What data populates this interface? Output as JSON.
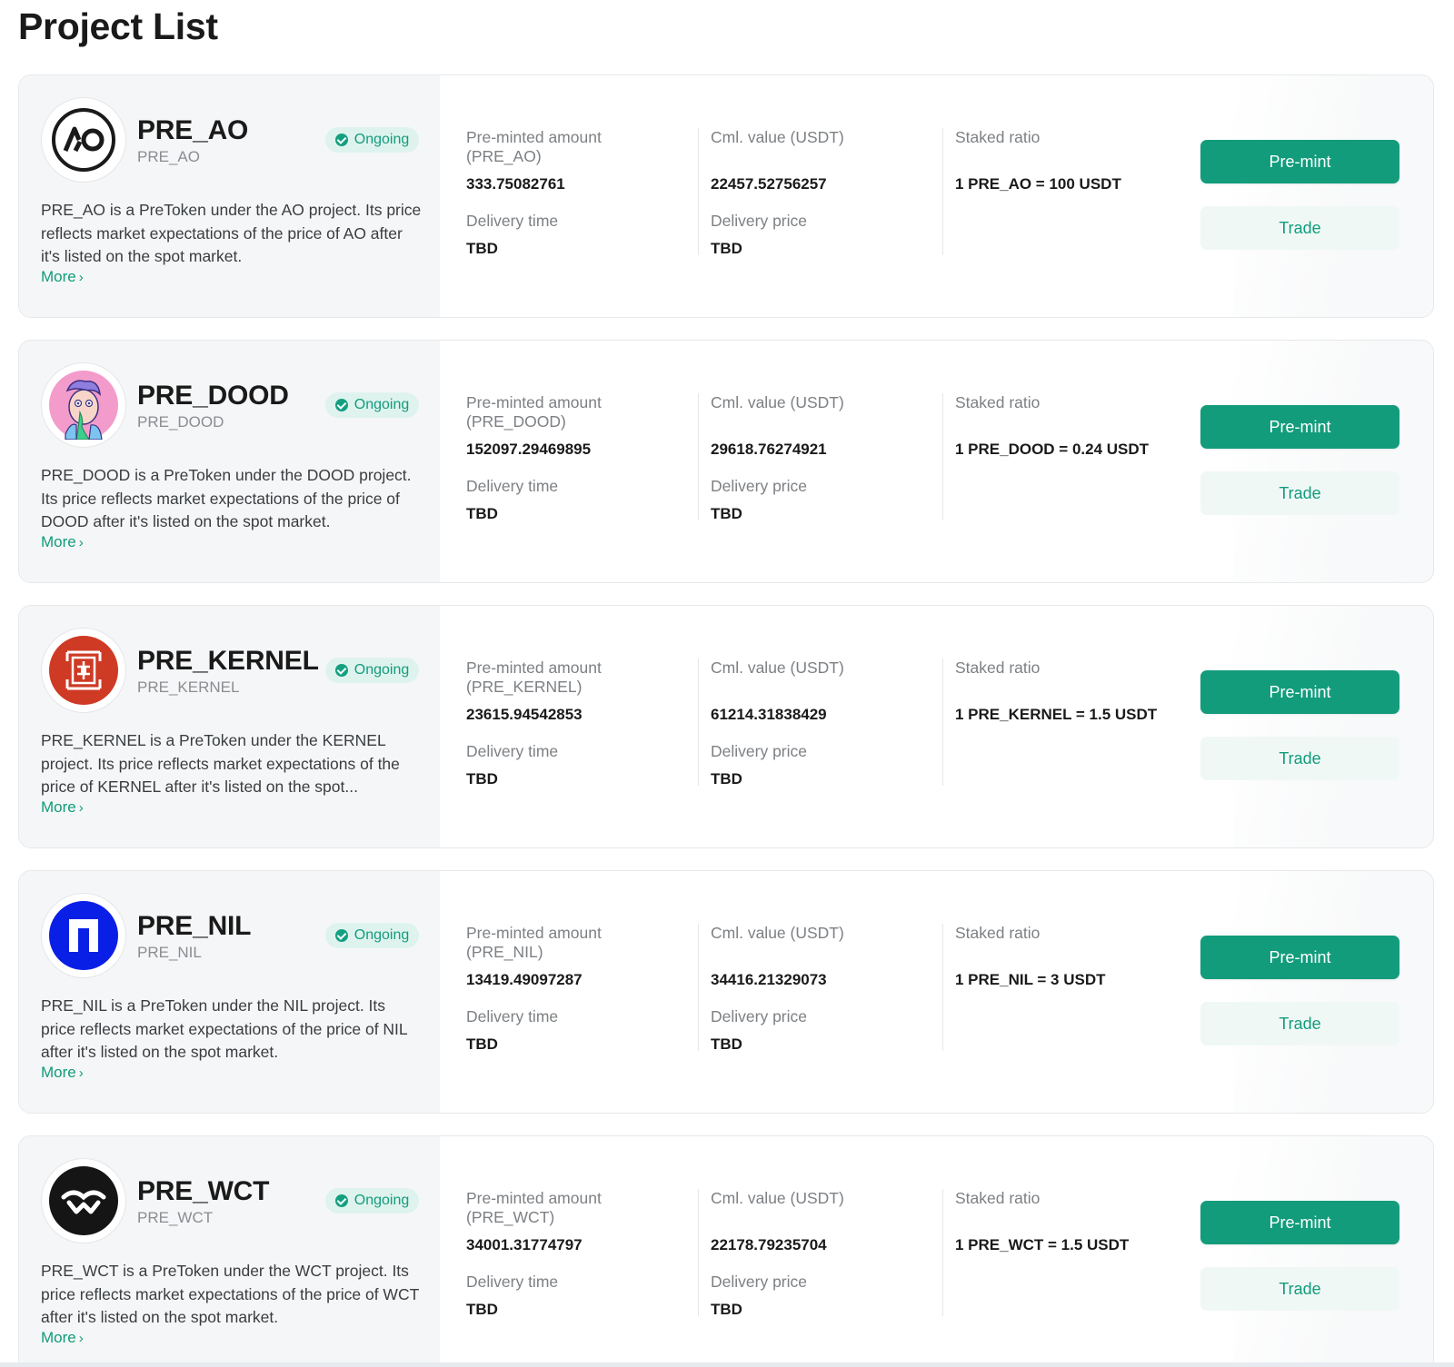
{
  "page": {
    "title": "Project List"
  },
  "colors": {
    "accent": "#129c7c",
    "badge_bg": "#dff3ee",
    "card_left_bg": "#f5f6f7"
  },
  "common": {
    "status": "Ongoing",
    "more": "More",
    "cml_label": "Cml. value (USDT)",
    "staked_label": "Staked ratio",
    "delivery_time_label": "Delivery time",
    "delivery_price_label": "Delivery price",
    "premint_button": "Pre-mint",
    "trade_button": "Trade"
  },
  "projects": [
    {
      "name": "PRE_AO",
      "symbol": "PRE_AO",
      "logo": "ao-logo-icon",
      "description": "PRE_AO is a PreToken under the AO project. Its price reflects market expectations of the price of AO after it's listed on the spot market.",
      "premint_label": "Pre-minted amount (PRE_AO)",
      "premint_amount": "333.75082761",
      "cml_value": "22457.52756257",
      "staked_ratio": "1 PRE_AO = 100 USDT",
      "delivery_time": "TBD",
      "delivery_price": "TBD"
    },
    {
      "name": "PRE_DOOD",
      "symbol": "PRE_DOOD",
      "logo": "dood-avatar-icon",
      "description": "PRE_DOOD is a PreToken under the DOOD project. Its price reflects market expectations of the price of DOOD after it's listed on the spot market.",
      "premint_label": "Pre-minted amount (PRE_DOOD)",
      "premint_amount": "152097.29469895",
      "cml_value": "29618.76274921",
      "staked_ratio": "1 PRE_DOOD = 0.24 USDT",
      "delivery_time": "TBD",
      "delivery_price": "TBD"
    },
    {
      "name": "PRE_KERNEL",
      "symbol": "PRE_KERNEL",
      "logo": "kernel-logo-icon",
      "description": "PRE_KERNEL is a PreToken under the KERNEL project. Its price reflects market expectations of the price of KERNEL after it's listed on the spot...",
      "premint_label": "Pre-minted amount (PRE_KERNEL)",
      "premint_amount": "23615.94542853",
      "cml_value": "61214.31838429",
      "staked_ratio": "1 PRE_KERNEL = 1.5 USDT",
      "delivery_time": "TBD",
      "delivery_price": "TBD"
    },
    {
      "name": "PRE_NIL",
      "symbol": "PRE_NIL",
      "logo": "nil-logo-icon",
      "description": "PRE_NIL is a PreToken under the NIL project. Its price reflects market expectations of the price of NIL after it's listed on the spot market.",
      "premint_label": "Pre-minted amount (PRE_NIL)",
      "premint_amount": "13419.49097287",
      "cml_value": "34416.21329073",
      "staked_ratio": "1 PRE_NIL = 3 USDT",
      "delivery_time": "TBD",
      "delivery_price": "TBD"
    },
    {
      "name": "PRE_WCT",
      "symbol": "PRE_WCT",
      "logo": "wct-logo-icon",
      "description": "PRE_WCT is a PreToken under the WCT project. Its price reflects market expectations of the price of WCT after it's listed on the spot market.",
      "premint_label": "Pre-minted amount (PRE_WCT)",
      "premint_amount": "34001.31774797",
      "cml_value": "22178.79235704",
      "staked_ratio": "1 PRE_WCT = 1.5 USDT",
      "delivery_time": "TBD",
      "delivery_price": "TBD"
    }
  ]
}
